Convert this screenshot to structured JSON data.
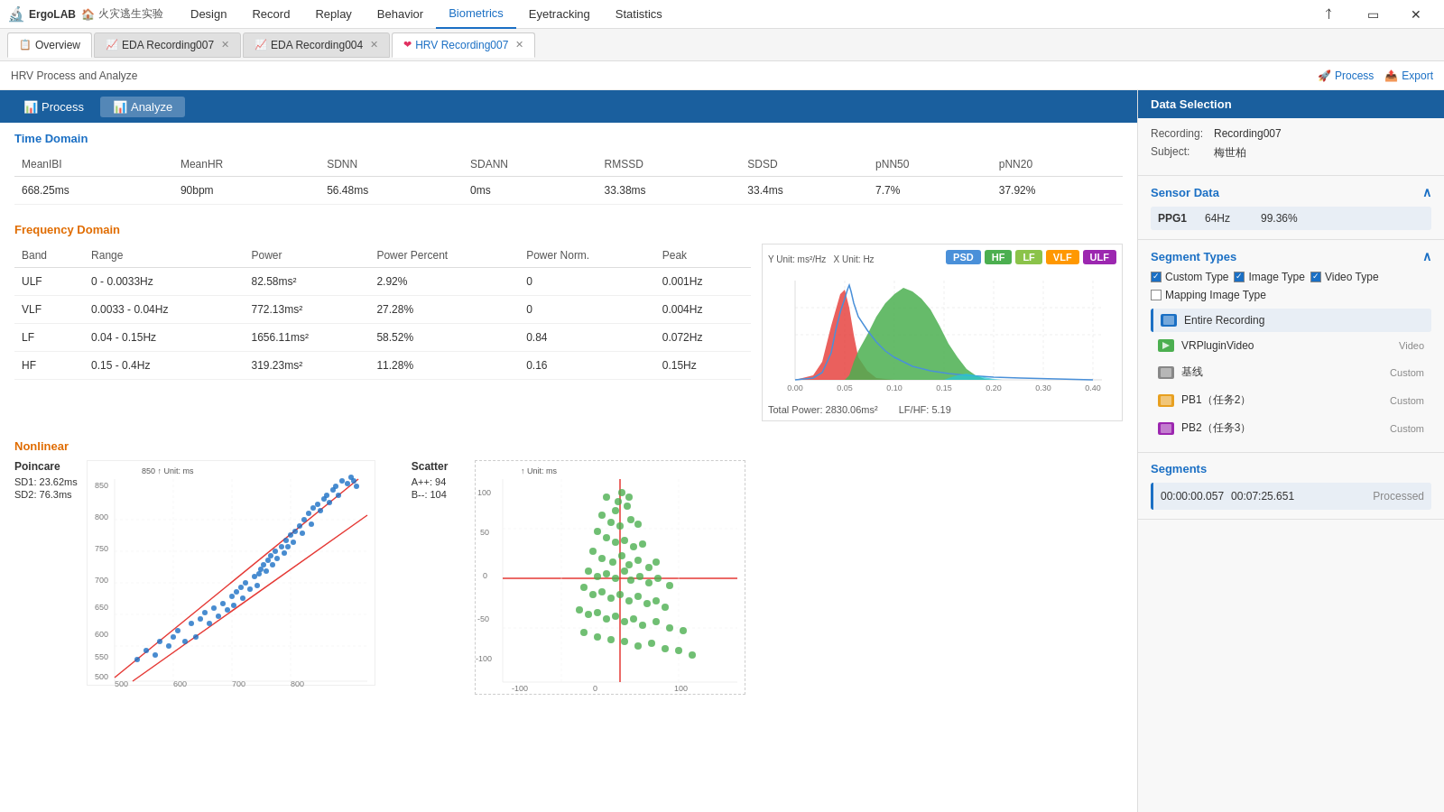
{
  "titlebar": {
    "app_name": "ErgoLAB",
    "project_name": "火灾逃生实验",
    "nav_items": [
      "Design",
      "Record",
      "Replay",
      "Behavior",
      "Biometrics",
      "Eyetracking",
      "Statistics"
    ],
    "active_nav": "Biometrics"
  },
  "tabs": [
    {
      "label": "Overview",
      "closable": false,
      "icon": "overview"
    },
    {
      "label": "EDA Recording007",
      "closable": true,
      "icon": "eda"
    },
    {
      "label": "EDA Recording004",
      "closable": true,
      "icon": "eda"
    },
    {
      "label": "HRV Recording007",
      "closable": true,
      "icon": "hrv",
      "active": true
    }
  ],
  "breadcrumb": "HRV Process and Analyze",
  "actions": {
    "process": "Process",
    "export": "Export"
  },
  "proc_tabs": [
    {
      "label": "Process",
      "icon": "chart"
    },
    {
      "label": "Analyze",
      "icon": "chart",
      "active": true
    }
  ],
  "time_domain": {
    "title": "Time Domain",
    "headers": [
      "MeanIBI",
      "MeanHR",
      "SDNN",
      "SDANN",
      "RMSSD",
      "SDSD",
      "pNN50",
      "pNN20"
    ],
    "values": [
      "668.25ms",
      "90bpm",
      "56.48ms",
      "0ms",
      "33.38ms",
      "33.4ms",
      "7.7%",
      "37.92%"
    ]
  },
  "frequency_domain": {
    "title": "Frequency Domain",
    "headers": [
      "Band",
      "Range",
      "Power",
      "Power Percent",
      "Power Norm.",
      "Peak"
    ],
    "rows": [
      {
        "band": "ULF",
        "range": "0 - 0.0033Hz",
        "power": "82.58ms²",
        "power_pct": "2.92%",
        "power_norm": "0",
        "peak": "0.001Hz"
      },
      {
        "band": "VLF",
        "range": "0.0033 - 0.04Hz",
        "power": "772.13ms²",
        "power_pct": "27.28%",
        "power_norm": "0",
        "peak": "0.004Hz"
      },
      {
        "band": "LF",
        "range": "0.04 - 0.15Hz",
        "power": "1656.11ms²",
        "power_pct": "58.52%",
        "power_norm": "0.84",
        "peak": "0.072Hz"
      },
      {
        "band": "HF",
        "range": "0.15 - 0.4Hz",
        "power": "319.23ms²",
        "power_pct": "11.28%",
        "power_norm": "0.16",
        "peak": "0.15Hz"
      }
    ],
    "chart_labels": {
      "y": "Y Unit: ms²/Hz",
      "x": "X Unit: Hz"
    },
    "legend": [
      "PSD",
      "HF",
      "LF",
      "VLF",
      "ULF"
    ],
    "legend_colors": [
      "#4a90d9",
      "#4caf50",
      "#8bc34a",
      "#ff9800",
      "#9c27b0"
    ],
    "total_power": "2830.06ms²",
    "lf_hf": "5.19"
  },
  "nonlinear": {
    "title": "Nonlinear",
    "poincare_title": "Poincare",
    "sd1": "23.62ms",
    "sd2": "76.3ms",
    "scatter_title": "Scatter",
    "scatter_a": "94",
    "scatter_b": "104"
  },
  "data_selection": {
    "title": "Data Selection",
    "recording_label": "Recording:",
    "recording_value": "Recording007",
    "subject_label": "Subject:",
    "subject_value": "梅世柏",
    "sensor_data_title": "Sensor Data",
    "sensor": {
      "name": "PPG1",
      "hz": "64Hz",
      "quality": "99.36%"
    },
    "segment_types_title": "Segment Types",
    "segment_types": [
      {
        "label": "Custom Type",
        "checked": true
      },
      {
        "label": "Image Type",
        "checked": true
      },
      {
        "label": "Video Type",
        "checked": true
      },
      {
        "label": "Mapping Image Type",
        "checked": false
      }
    ],
    "segments_list": [
      {
        "label": "Entire Recording",
        "type": "",
        "color": "#1a6fc4",
        "selected": true
      },
      {
        "label": "VRPluginVideo",
        "type": "Video",
        "color": "#4caf50"
      },
      {
        "label": "基线",
        "type": "Custom",
        "color": "#888"
      },
      {
        "label": "PB1（任务2）",
        "type": "Custom",
        "color": "#e8a020"
      },
      {
        "label": "PB2（任务3）",
        "type": "Custom",
        "color": "#9c27b0"
      }
    ],
    "segments_title": "Segments",
    "segment_time": {
      "start": "00:00:00.057",
      "end": "00:07:25.651",
      "status": "Processed"
    }
  }
}
